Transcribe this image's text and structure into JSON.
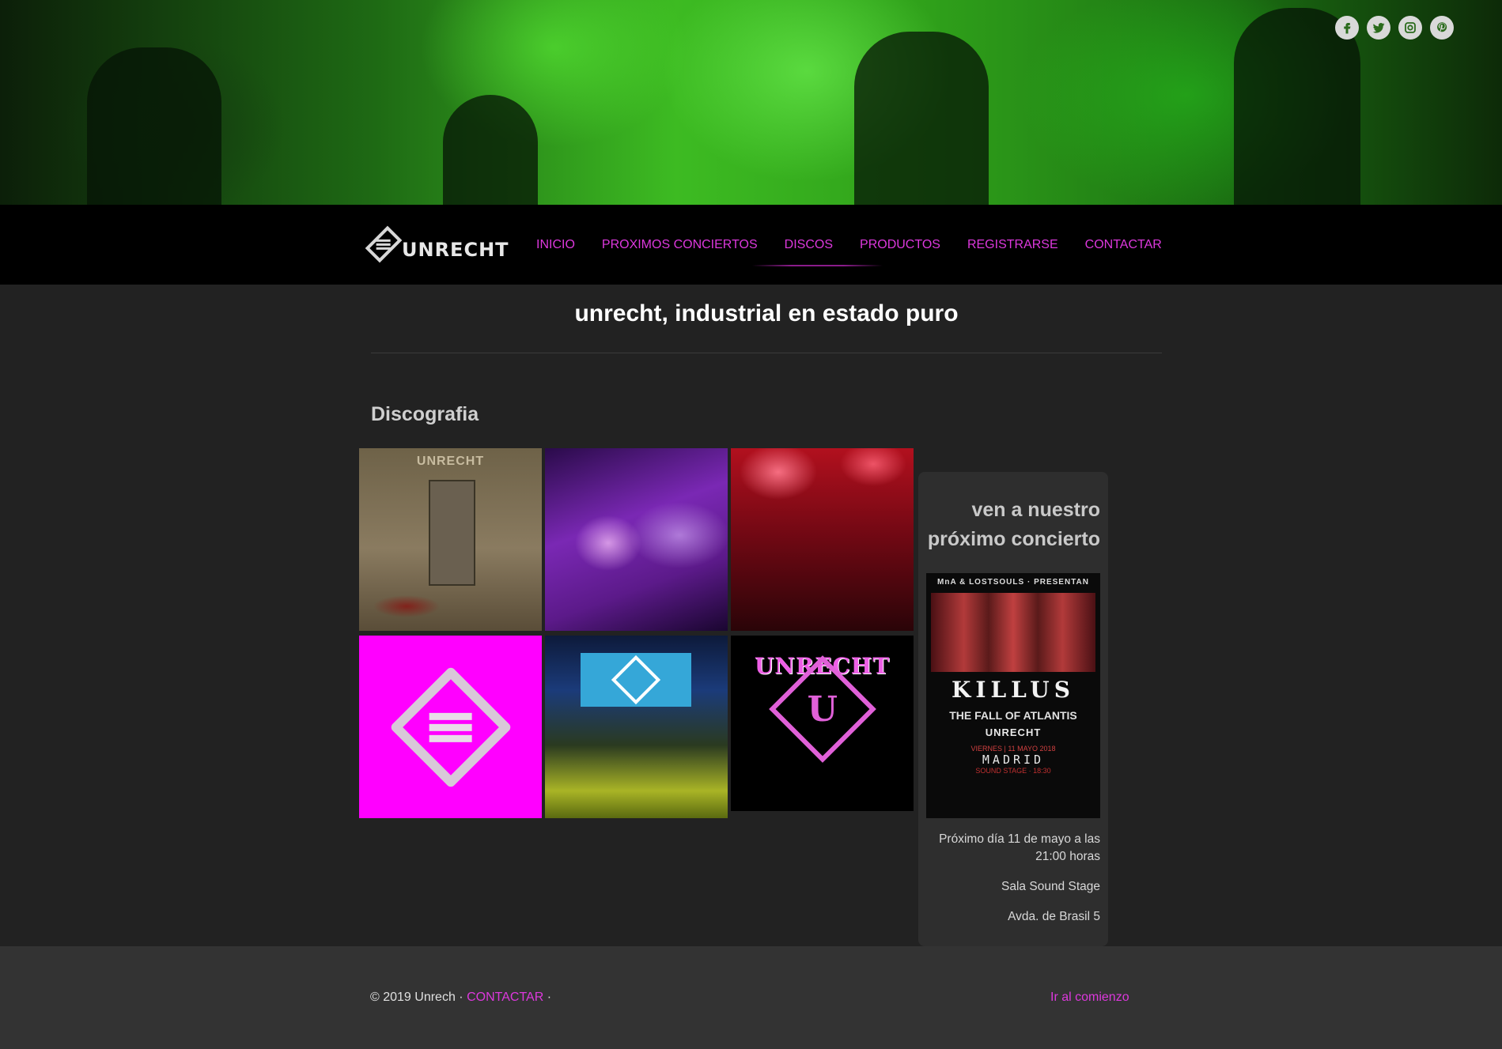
{
  "hero": {
    "social": [
      {
        "icon": "facebook-icon",
        "glyph": "f"
      },
      {
        "icon": "twitter-icon",
        "glyph": "t"
      },
      {
        "icon": "instagram-icon",
        "glyph": "◎"
      },
      {
        "icon": "pinterest-icon",
        "glyph": "p"
      }
    ]
  },
  "navbar": {
    "logo_text": "UNRECHT",
    "items": [
      {
        "label": "INICIO"
      },
      {
        "label": "PROXIMOS CONCIERTOS"
      },
      {
        "label": "DISCOS"
      },
      {
        "label": "PRODUCTOS"
      },
      {
        "label": "REGISTRARSE"
      },
      {
        "label": "CONTACTAR"
      }
    ],
    "active": "DISCOS"
  },
  "main": {
    "title": "unrecht, industrial en estado puro",
    "section_title": "Discografia",
    "gallery": {
      "t1_brand": "UNRECHT",
      "t6_word": "UNRECHT",
      "t6_letter": "U"
    }
  },
  "concert": {
    "heading_line1": "ven a nuestro",
    "heading_line2": "próximo concierto",
    "poster": {
      "head": "MnA & LOSTSOULS · PRESENTAN",
      "title": "KILLUS",
      "bands": "THE FALL OF ATLANTIS",
      "band3": "UNRECHT",
      "city_line": "VIERNES | 11 MAYO 2018",
      "city": "MADRID",
      "venue": "SOUND STAGE · 18:30"
    },
    "date": "Próximo día 11 de mayo a las 21:00 horas",
    "venue": "Sala Sound Stage",
    "address": "Avda. de Brasil 5"
  },
  "footer": {
    "copyright": "© 2019 Unrech · ",
    "contact_link": "CONTACTAR",
    "sep": " ·",
    "back_to_top": "Ir al comienzo"
  },
  "colors": {
    "accent": "#dd38dd",
    "background": "#222222",
    "navbar": "#000000",
    "footer": "#333333"
  }
}
